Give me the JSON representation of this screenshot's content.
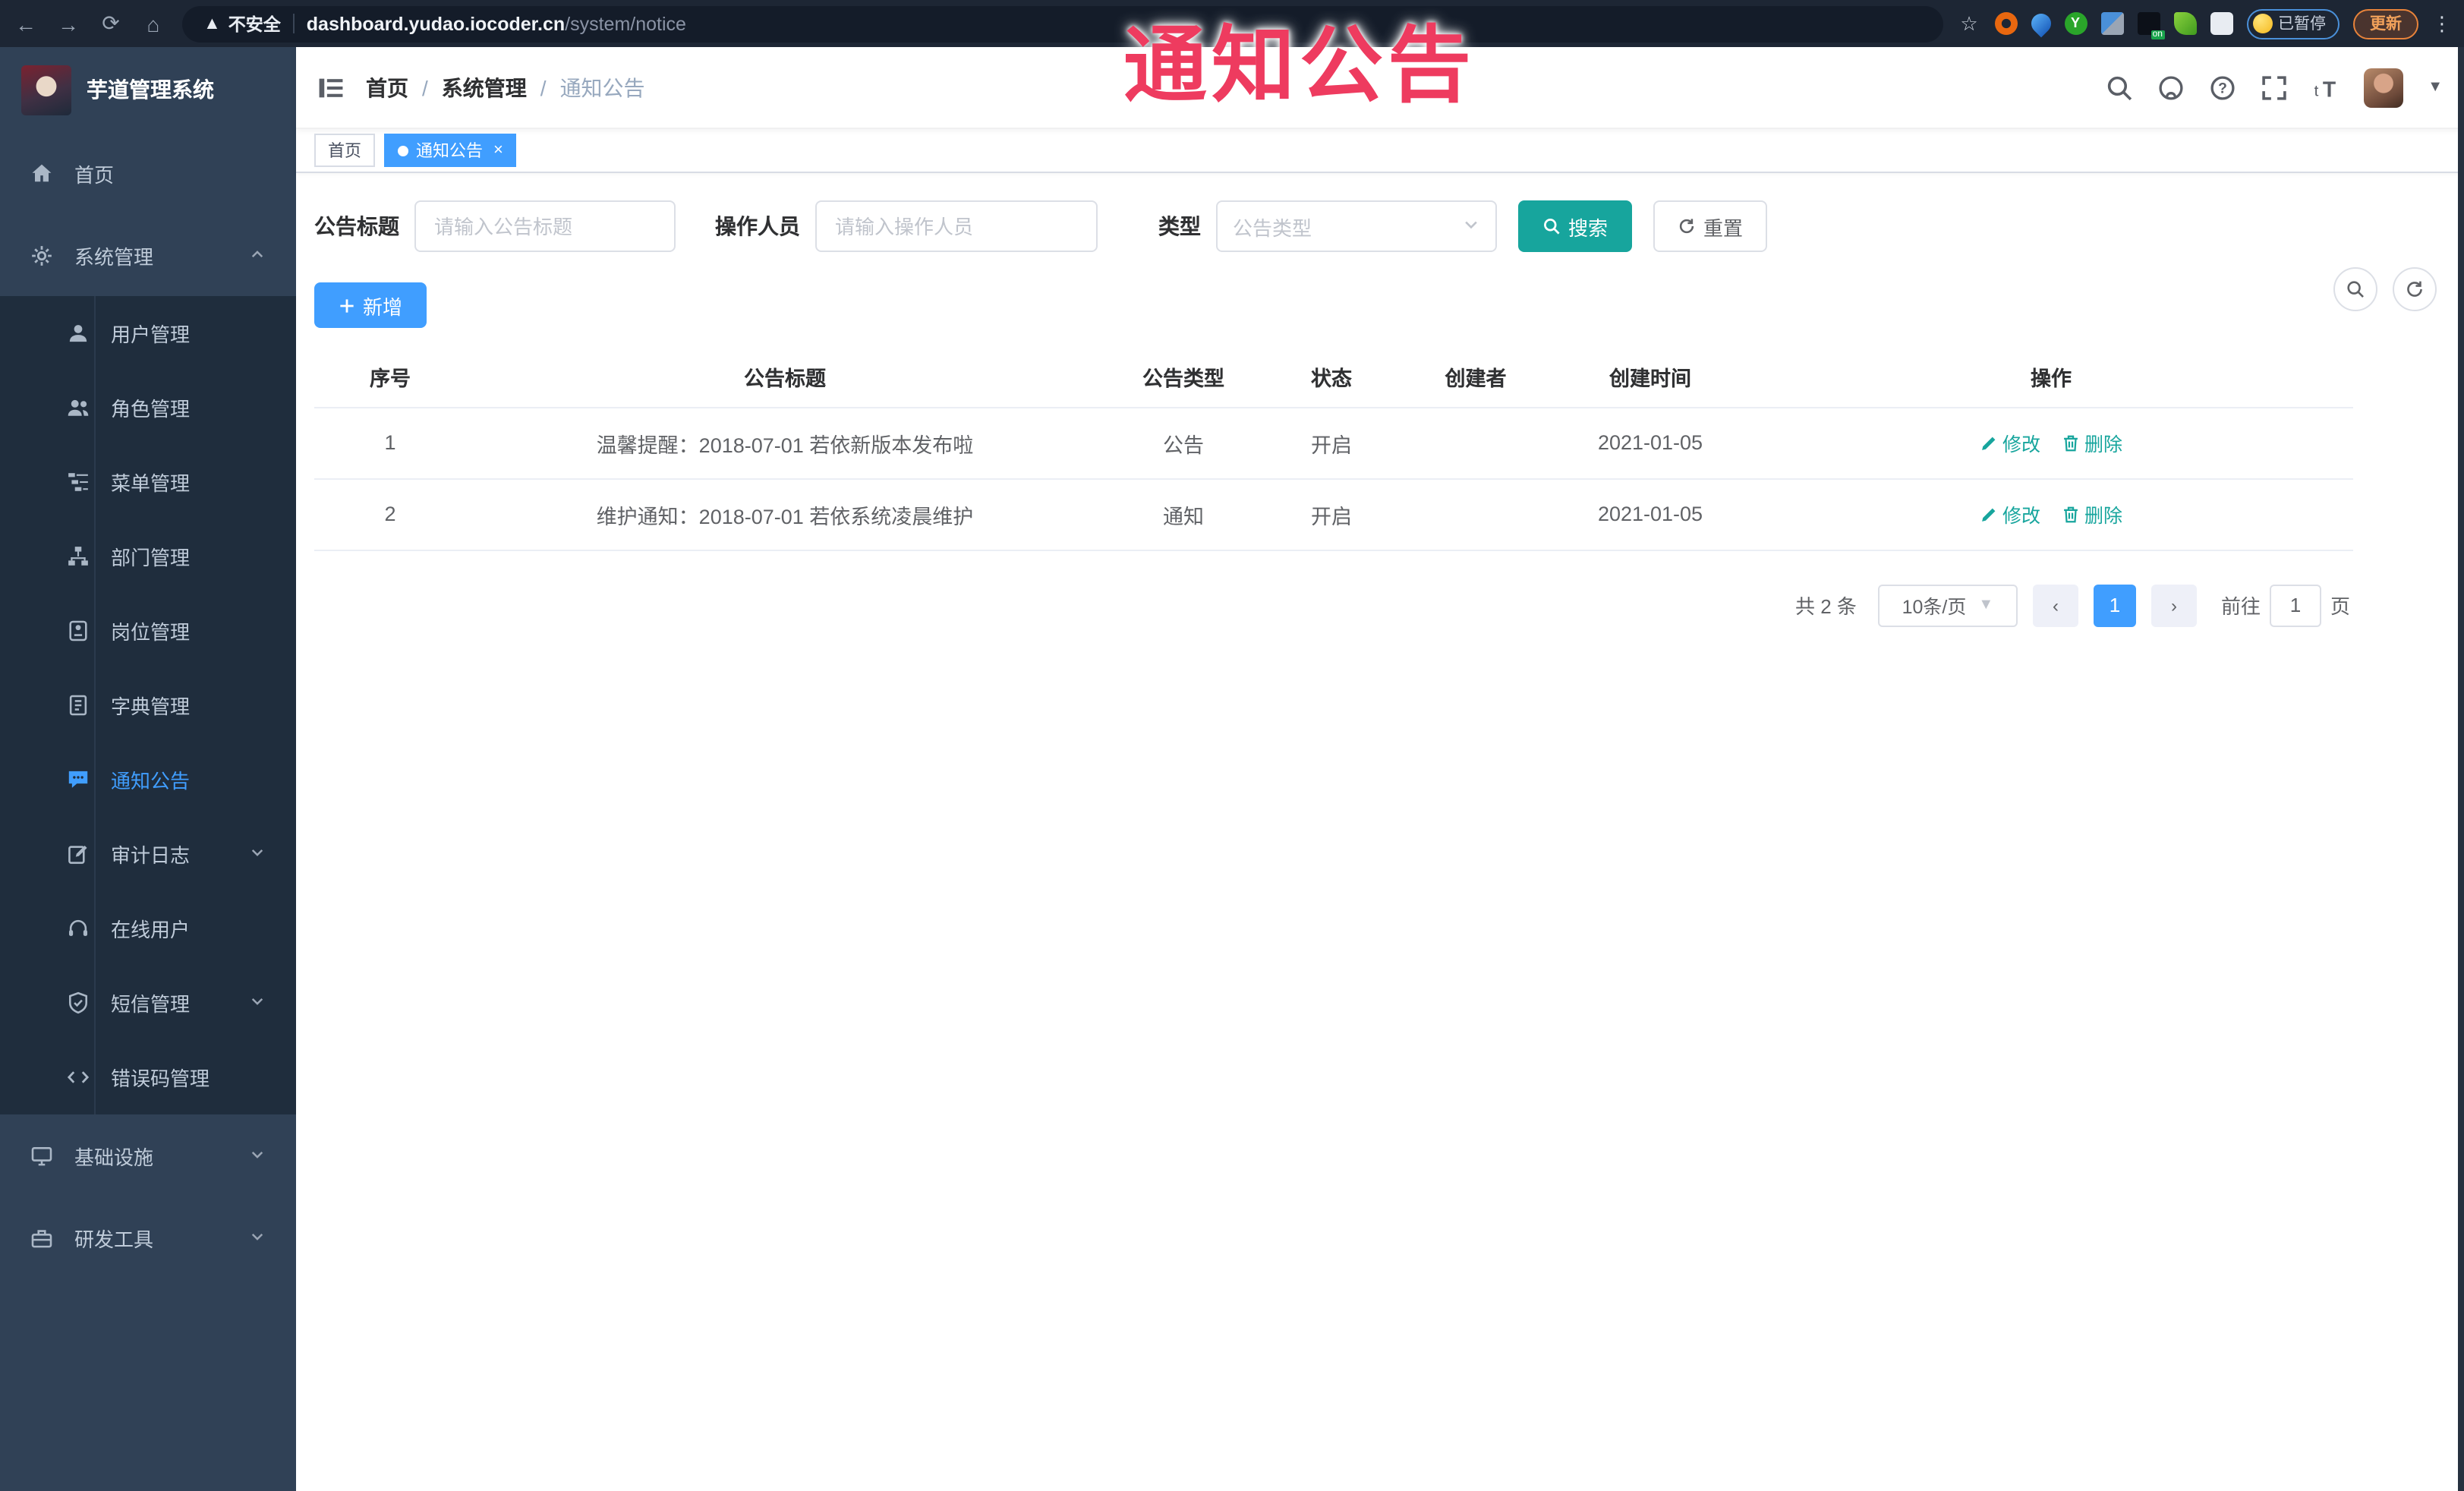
{
  "watermark_text": "通知公告",
  "colors": {
    "primary": "#409EFF",
    "accent_teal": "#17A59D",
    "sidebar_bg": "#304156",
    "submenu_bg": "#1F2D3D",
    "watermark": "#EE3B5F",
    "tag_active": "#409EFF"
  },
  "browser": {
    "security_label": "不安全",
    "url_host": "dashboard.yudao.iocoder.cn",
    "url_path": "/system/notice",
    "paused_label": "已暂停",
    "update_label": "更新",
    "nav_icons": [
      "back-icon",
      "forward-icon",
      "reload-icon",
      "home-icon"
    ],
    "extensions": [
      "bookmark-star-icon",
      "orange-extension-icon",
      "blue-drop-extension-icon",
      "green-y-extension-icon",
      "grid-extension-icon",
      "on-badge-extension-icon",
      "leaf-extension-icon",
      "puzzle-extension-icon"
    ]
  },
  "sidebar": {
    "app_title": "芋道管理系统",
    "items": [
      {
        "label": "首页",
        "icon": "home-icon",
        "level": 1
      },
      {
        "label": "系统管理",
        "icon": "gear-icon",
        "level": 1,
        "arrow": "up",
        "expanded": true
      },
      {
        "label": "用户管理",
        "icon": "user-icon",
        "level": 2
      },
      {
        "label": "角色管理",
        "icon": "users-icon",
        "level": 2
      },
      {
        "label": "菜单管理",
        "icon": "menu-tree-icon",
        "level": 2
      },
      {
        "label": "部门管理",
        "icon": "org-tree-icon",
        "level": 2
      },
      {
        "label": "岗位管理",
        "icon": "id-badge-icon",
        "level": 2
      },
      {
        "label": "字典管理",
        "icon": "book-icon",
        "level": 2
      },
      {
        "label": "通知公告",
        "icon": "comment-icon",
        "level": 2,
        "active": true
      },
      {
        "label": "审计日志",
        "icon": "edit-log-icon",
        "level": 2,
        "arrow": "down"
      },
      {
        "label": "在线用户",
        "icon": "online-user-icon",
        "level": 2
      },
      {
        "label": "短信管理",
        "icon": "shield-icon",
        "level": 2,
        "arrow": "down"
      },
      {
        "label": "错误码管理",
        "icon": "code-icon",
        "level": 2
      },
      {
        "label": "基础设施",
        "icon": "monitor-icon",
        "level": 1,
        "arrow": "down"
      },
      {
        "label": "研发工具",
        "icon": "toolbox-icon",
        "level": 1,
        "arrow": "down"
      }
    ]
  },
  "header": {
    "breadcrumb": [
      "首页",
      "系统管理",
      "通知公告"
    ],
    "right_icons": [
      "search-icon",
      "github-icon",
      "help-icon",
      "fullscreen-icon",
      "font-size-icon",
      "avatar",
      "caret-down-icon"
    ]
  },
  "tabs": [
    {
      "label": "首页",
      "active": false
    },
    {
      "label": "通知公告",
      "active": true,
      "closable": true
    }
  ],
  "filters": {
    "title_label": "公告标题",
    "title_placeholder": "请输入公告标题",
    "operator_label": "操作人员",
    "operator_placeholder": "请输入操作人员",
    "type_label": "类型",
    "type_placeholder": "公告类型",
    "search_label": "搜索",
    "reset_label": "重置"
  },
  "toolbar": {
    "add_label": "新增"
  },
  "table": {
    "headers": [
      "序号",
      "公告标题",
      "公告类型",
      "状态",
      "创建者",
      "创建时间",
      "操作"
    ],
    "rows": [
      {
        "no": "1",
        "title": "温馨提醒：2018-07-01 若依新版本发布啦",
        "type": "公告",
        "status": "开启",
        "creator": "",
        "created": "2021-01-05"
      },
      {
        "no": "2",
        "title": "维护通知：2018-07-01 若依系统凌晨维护",
        "type": "通知",
        "status": "开启",
        "creator": "",
        "created": "2021-01-05"
      }
    ],
    "edit_label": "修改",
    "delete_label": "删除"
  },
  "pagination": {
    "total_label": "共 2 条",
    "page_size_label": "10条/页",
    "prev_label": "‹",
    "current_page": "1",
    "next_label": "›",
    "goto_label": "前往",
    "goto_value": "1",
    "page_unit_label": "页"
  }
}
